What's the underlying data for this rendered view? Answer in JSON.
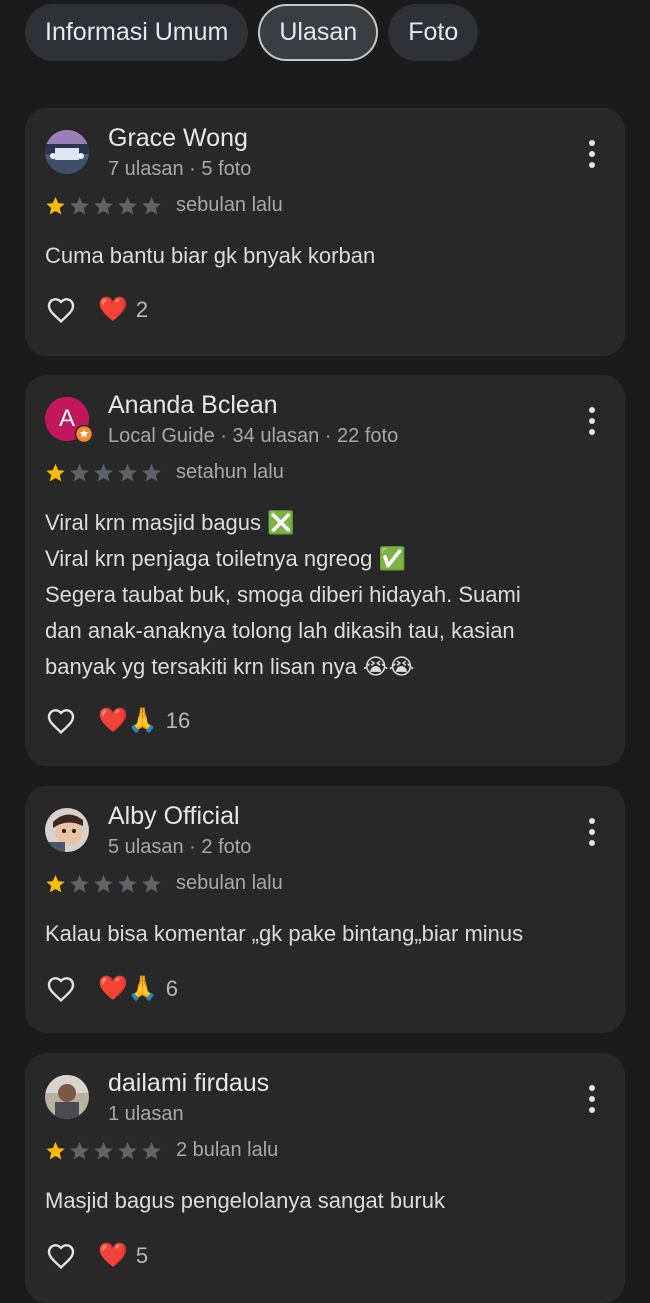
{
  "tabs": [
    {
      "label": "Informasi Umum",
      "active": false
    },
    {
      "label": "Ulasan",
      "active": true
    },
    {
      "label": "Foto",
      "active": false
    }
  ],
  "reviews": [
    {
      "name": "Grace Wong",
      "meta": "7 ulasan · 5 foto",
      "rating": 1,
      "when": "sebulan lalu",
      "lines": [
        "Cuma bantu biar gk bnyak korban"
      ],
      "reactions": "❤️",
      "count": "2"
    },
    {
      "name": "Ananda Bclean",
      "avatar_letter": "A",
      "meta": "Local Guide · 34 ulasan · 22 foto",
      "rating": 1,
      "when": "setahun lalu",
      "lines": [
        "Viral krn masjid bagus ❎",
        "Viral krn penjaga toiletnya ngreog ✅",
        "Segera taubat buk, smoga diberi hidayah. Suami",
        "dan anak-anaknya tolong lah dikasih tau, kasian",
        "banyak yg tersakiti krn lisan nya 😭😭"
      ],
      "reactions": "❤️🙏",
      "count": "16"
    },
    {
      "name": "Alby Official",
      "meta": "5 ulasan · 2 foto",
      "rating": 1,
      "when": "sebulan lalu",
      "lines": [
        "Kalau bisa komentar „gk pake bintang„biar minus"
      ],
      "reactions": "❤️🙏",
      "count": "6"
    },
    {
      "name": "dailami firdaus",
      "meta": "1 ulasan",
      "rating": 1,
      "when": "2 bulan lalu",
      "lines": [
        "Masjid bagus pengelolanya sangat buruk"
      ],
      "reactions": "❤️",
      "count": "5"
    }
  ],
  "colors": {
    "background": "#1b1b1c",
    "card": "#282829",
    "star_filled": "#fbbc04",
    "star_empty": "#5f6368",
    "avatar_letter_bg": "#c2185b"
  },
  "icons": {
    "like": "heart-outline-icon",
    "more": "more-vert-icon",
    "star": "star-icon"
  }
}
